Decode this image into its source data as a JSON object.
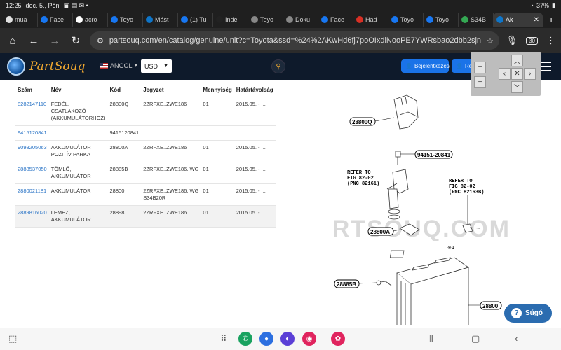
{
  "status_bar": {
    "time": "12:25",
    "date": "dec. 5., Pén",
    "battery": "37%"
  },
  "tabs": [
    {
      "label": "mua",
      "color": "#e0e0e0"
    },
    {
      "label": "Face",
      "color": "#1877f2"
    },
    {
      "label": "acro",
      "color": "#ffffff"
    },
    {
      "label": "Toyo",
      "color": "#1877f2"
    },
    {
      "label": "Mást",
      "color": "#0e75c9"
    },
    {
      "label": "(1) Tu",
      "color": "#1877f2"
    },
    {
      "label": "Inde",
      "color": "#222222"
    },
    {
      "label": "Toyo",
      "color": "#888888"
    },
    {
      "label": "Doku",
      "color": "#888888"
    },
    {
      "label": "Face",
      "color": "#1877f2"
    },
    {
      "label": "Had",
      "color": "#d93025"
    },
    {
      "label": "Toyo",
      "color": "#1877f2"
    },
    {
      "label": "Toyo",
      "color": "#1877f2"
    },
    {
      "label": "S34B",
      "color": "#34a853"
    },
    {
      "label": "Ak",
      "color": "#0e75c9",
      "active": true
    }
  ],
  "omnibar": {
    "url": "partsouq.com/en/catalog/genuine/unit?c=Toyota&ssd=%24%2AKwHd6fj7poOIxdiNooPE7YWRsbao2dbb2sjn",
    "tab_count": "30"
  },
  "header": {
    "brand": "PartSouq",
    "language": "ANGOL",
    "currency": "USD",
    "login_label": "Bejelentkezés",
    "register_label": "Regisztráció",
    "cart_count": "0"
  },
  "table": {
    "headers": [
      "Szám",
      "Név",
      "Kód",
      "Jegyzet",
      "Mennyiség",
      "Határtávolság"
    ],
    "rows": [
      {
        "num": "8282147110",
        "name": "FEDÉL, CSATLAKOZÓ (AKKUMULÁTORHOZ)",
        "code": "28800Q",
        "note": "2ZRFXE..ZWE186",
        "qty": "01",
        "range": "2015.05. - ..."
      },
      {
        "num": "9415120841",
        "name": "",
        "code": "9415120841",
        "note": "",
        "qty": "",
        "range": ""
      },
      {
        "num": "9098205063",
        "name": "AKKUMULÁTOR POZITÍV PARKA",
        "code": "28800A",
        "note": "2ZRFXE..ZWE186",
        "qty": "01",
        "range": "2015.05. - ..."
      },
      {
        "num": "2888537050",
        "name": "TÖMLŐ, AKKUMULÁTOR",
        "code": "28885B",
        "note": "2ZRFXE..ZWE186..WG",
        "qty": "01",
        "range": "2015.05. - ..."
      },
      {
        "num": "2880021181",
        "name": "AKKUMULÁTOR",
        "code": "28800",
        "note": "2ZRFXE..ZWE186..WG S34B20R",
        "qty": "01",
        "range": "2015.05. - ..."
      },
      {
        "num": "2889816020",
        "name": "LEMEZ, AKKUMULÁTOR",
        "code": "28898",
        "note": "2ZRFXE..ZWE186",
        "qty": "01",
        "range": "2015.05. - ..."
      }
    ]
  },
  "diagram": {
    "labels": [
      "28800Q",
      "94151-20841",
      "28800A",
      "28885B",
      "28800"
    ],
    "refer_left": [
      "REFER TO",
      "FIG 82-02",
      "(PNC 82161)"
    ],
    "refer_right": [
      "REFER TO",
      "FIG 82-02",
      "(PNC 82163B)"
    ],
    "watermark": "PARTSOUQ.COM",
    "marker": "※1"
  },
  "zoom": {
    "plus": "+",
    "minus": "−",
    "reset": "✕"
  },
  "help": {
    "label": "Súgó"
  }
}
